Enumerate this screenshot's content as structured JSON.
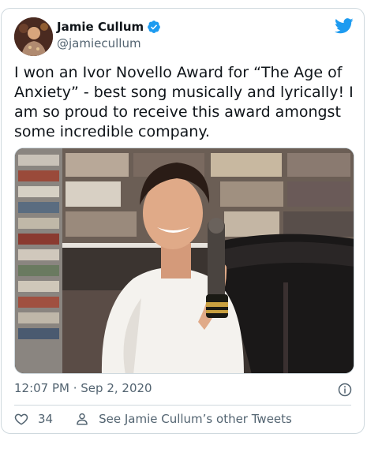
{
  "author": {
    "name": "Jamie Cullum",
    "handle": "@jamiecullum",
    "verified": true
  },
  "tweet": {
    "text": "I won an Ivor Novello Award for “The Age of Anxiety” - best song musically and lyrically! I am so proud to receive this award amongst some incredible company.",
    "timestamp": "12:07 PM · Sep 2, 2020",
    "like_count": "34",
    "see_more_label": "See Jamie Cullum’s other Tweets"
  },
  "icons": {
    "brand": "twitter-bird-icon",
    "verified": "verified-badge-icon",
    "info": "info-icon",
    "like": "heart-icon",
    "profile": "person-icon"
  },
  "colors": {
    "brand": "#1d9bf0",
    "text": "#0f1419",
    "secondary": "#536471",
    "border": "#cfd9de"
  }
}
